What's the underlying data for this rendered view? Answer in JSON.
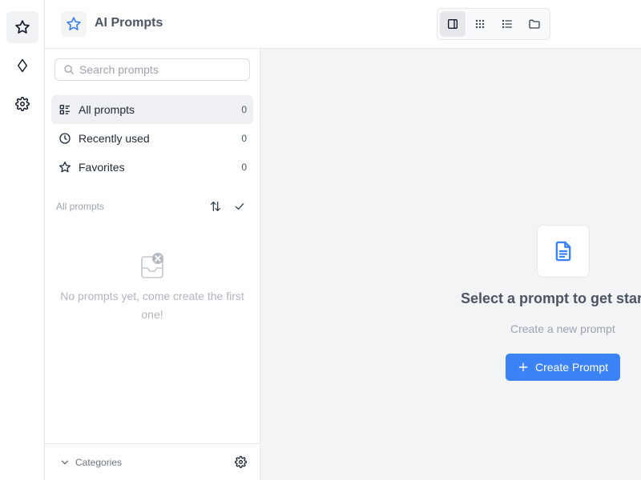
{
  "header": {
    "title": "AI Prompts",
    "brand_icon": "star-icon",
    "view_modes": [
      {
        "name": "sidebar-layout",
        "icon": "sidebar-panel-icon",
        "active": true
      },
      {
        "name": "grid",
        "icon": "grid-dots-icon",
        "active": false
      },
      {
        "name": "list",
        "icon": "list-icon",
        "active": false
      },
      {
        "name": "folder",
        "icon": "folder-icon",
        "active": false
      }
    ]
  },
  "rail": {
    "items": [
      {
        "icon": "star-icon",
        "active": true
      },
      {
        "icon": "diamond-icon",
        "active": false
      },
      {
        "icon": "gear-icon",
        "active": false
      }
    ]
  },
  "sidebar": {
    "search": {
      "placeholder": "Search prompts",
      "value": ""
    },
    "nav": [
      {
        "label": "All prompts",
        "count": "0",
        "icon": "list-grid-icon",
        "active": true
      },
      {
        "label": "Recently used",
        "count": "0",
        "icon": "clock-icon",
        "active": false
      },
      {
        "label": "Favorites",
        "count": "0",
        "icon": "star-icon",
        "active": false
      }
    ],
    "section_label": "All prompts",
    "empty_text": "No prompts yet, come create the first one!",
    "footer_label": "Categories"
  },
  "main": {
    "title": "Select a prompt to get started",
    "subtitle": "Create a new prompt",
    "create_label": "Create Prompt"
  },
  "colors": {
    "accent": "#3b82f6",
    "border": "#e5e7eb",
    "main_bg": "#f3f4f6"
  }
}
